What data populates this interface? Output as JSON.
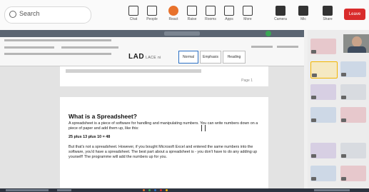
{
  "meeting": {
    "search_placeholder": "Search",
    "toolbar_buttons": [
      {
        "label": "Chat",
        "icon": "chat-icon"
      },
      {
        "label": "People",
        "icon": "people-icon"
      },
      {
        "label": "React",
        "icon": "react-icon"
      },
      {
        "label": "Raise",
        "icon": "raise-hand-icon"
      },
      {
        "label": "Rooms",
        "icon": "rooms-icon"
      },
      {
        "label": "Apps",
        "icon": "apps-icon"
      },
      {
        "label": "More",
        "icon": "more-icon"
      },
      {
        "label": "Camera",
        "icon": "camera-icon"
      },
      {
        "label": "Mic",
        "icon": "mic-icon"
      },
      {
        "label": "Share",
        "icon": "share-icon"
      }
    ],
    "end_label": "Leave",
    "end_color": "#d92b2b"
  },
  "document": {
    "style_preview": "LAD",
    "style_preview_suffix": "LACE ni",
    "style_boxes": [
      "Normal",
      "Emphasis",
      "Heading"
    ],
    "page1_number": "Page 1",
    "heading": "What is a Spreadsheet?",
    "para1": "A spreadsheet is a piece of software for handling and manipulating numbers. You can write numbers down on a piece of paper and add them up, like this:",
    "bold_line": "25 plus 13 plus 10 = 48",
    "para2": "But that's not a spreadsheet. However, if you bought Microsoft Excel and entered the same numbers into the software, you'd have a spreadsheet. The best part about a spreadsheet is - you don't have to do any adding up yourself! The programme will add the numbers up for you."
  },
  "colors": {
    "accent_active_tile": "#f2b500",
    "titlebar": "#5b6572"
  }
}
